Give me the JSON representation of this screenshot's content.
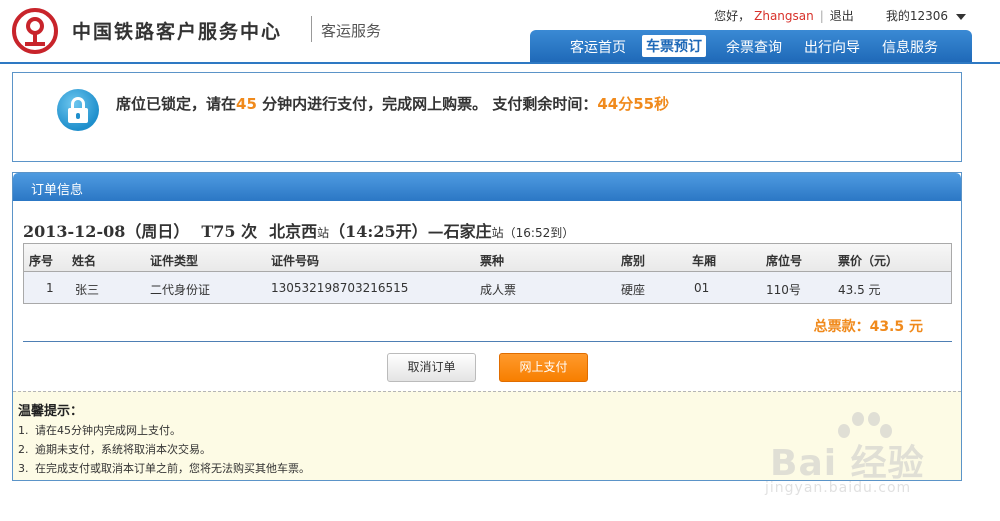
{
  "header": {
    "brand": "中国铁路客户服务中心",
    "sub": "客运服务",
    "greeting": "您好，",
    "username": "Zhangsan",
    "sep": "|",
    "logout": "退出",
    "my12306": "我的12306",
    "nav": [
      {
        "label": "客运首页",
        "active": false
      },
      {
        "label": "车票预订",
        "active": true
      },
      {
        "label": "余票查询",
        "active": false
      },
      {
        "label": "出行向导",
        "active": false
      },
      {
        "label": "信息服务",
        "active": false
      }
    ]
  },
  "notice": {
    "pre": "席位已锁定，请在",
    "minutes": "45",
    "mid": "分钟内进行支付，完成网上购票。 支付剩余时间：",
    "remaining": "44分55秒"
  },
  "order": {
    "panel_title": "订单信息",
    "date": "2013-12-08（周日）",
    "train": "T75 次",
    "from": "北京西",
    "station_word": "站",
    "depart": "（14:25开）",
    "dash": "—",
    "to": "石家庄",
    "arrive": "（16:52到）",
    "columns": [
      "序号",
      "姓名",
      "证件类型",
      "证件号码",
      "票种",
      "席别",
      "车厢",
      "席位号",
      "票价（元）"
    ],
    "rows": [
      [
        "1",
        "张三",
        "二代身份证",
        "130532198703216515",
        "成人票",
        "硬座",
        "01",
        "110号",
        "43.5 元"
      ]
    ],
    "total": "总票款：43.5 元",
    "cancel_label": "取消订单",
    "pay_label": "网上支付"
  },
  "tips": {
    "title": "温馨提示：",
    "items": [
      {
        "n": "1.",
        "text": "请在45分钟内完成网上支付。"
      },
      {
        "n": "2.",
        "text": "逾期未支付，系统将取消本次交易。"
      },
      {
        "n": "3.",
        "text": "在完成支付或取消本订单之前，您将无法购买其他车票。"
      }
    ]
  },
  "watermark": {
    "text": "Bai 经验",
    "url": "jingyan.baidu.com"
  },
  "colors": {
    "nav_blue": "#2b77c5",
    "accent_orange": "#f08a1c",
    "brand_red": "#d8322b"
  }
}
